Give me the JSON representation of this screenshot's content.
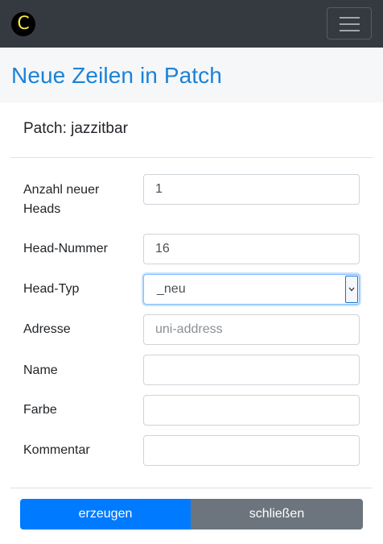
{
  "navbar": {
    "logo_letter": "C",
    "logo_icon": "c-logo-icon",
    "toggler_icon": "hamburger-icon"
  },
  "header": {
    "title": "Neue Zeilen in Patch"
  },
  "patch": {
    "label": "Patch: jazzitbar"
  },
  "form": {
    "anzahl": {
      "label_line1": "Anzahl neuer",
      "label_line2": "Heads",
      "value": "1"
    },
    "head_nummer": {
      "label": "Head-Nummer",
      "value": "16"
    },
    "head_typ": {
      "label": "Head-Typ",
      "value": "_neu"
    },
    "adresse": {
      "label": "Adresse",
      "value": "",
      "placeholder": "uni-address"
    },
    "name": {
      "label": "Name",
      "value": ""
    },
    "farbe": {
      "label": "Farbe",
      "value": ""
    },
    "kommentar": {
      "label": "Kommentar",
      "value": ""
    }
  },
  "actions": {
    "create_label": "erzeugen",
    "close_label": "schließen"
  },
  "colors": {
    "navbar": "#343a40",
    "title": "#1b82d8",
    "primary": "#007bff",
    "secondary": "#6c757d",
    "logo_letter": "#f2e84b"
  }
}
